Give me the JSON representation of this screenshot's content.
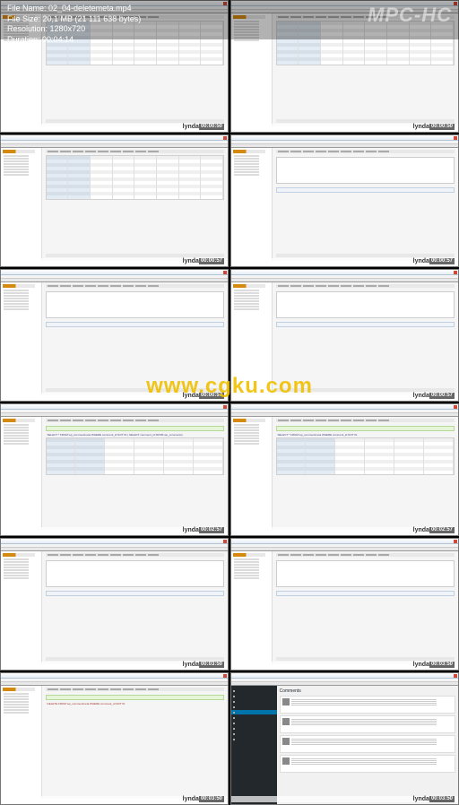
{
  "header": {
    "file_name_label": "File Name:",
    "file_name": "02_04-deletemeta.mp4",
    "file_size_label": "File Size:",
    "file_size": "20,1 MB (21 111 638 bytes)",
    "resolution_label": "Resolution:",
    "resolution": "1280x720",
    "duration_label": "Duration:",
    "duration": "00:04:14",
    "app_name": "MPC-HC"
  },
  "center_watermark": "www.cgku.com",
  "brand_watermark": "lynda",
  "thumbnails": [
    {
      "type": "pma-table",
      "timestamp": "00:00:50"
    },
    {
      "type": "pma-table",
      "timestamp": "00:00:50"
    },
    {
      "type": "pma-table",
      "timestamp": "00:00:57"
    },
    {
      "type": "pma-query",
      "timestamp": "00:00:57"
    },
    {
      "type": "pma-query",
      "timestamp": "00:00:57"
    },
    {
      "type": "pma-query",
      "timestamp": "00:00:57"
    },
    {
      "type": "pma-results",
      "timestamp": "00:02:57",
      "sql": "SELECT *\nFROM wp_commentmeta\nWHERE comment_id\nNOT IN (\nSELECT comment_id\nFROM wp_comments)"
    },
    {
      "type": "pma-results",
      "timestamp": "00:02:57",
      "sql": "SELECT *\nFROM wp_commentmeta\nWHERE comment_id NOT IN"
    },
    {
      "type": "pma-query",
      "timestamp": "00:03:50"
    },
    {
      "type": "pma-query",
      "timestamp": "00:03:50"
    },
    {
      "type": "pma-delete",
      "timestamp": "00:03:50",
      "sql": "DELETE FROM wp_commentmeta WHERE comment_id NOT IN"
    },
    {
      "type": "wp-comments",
      "timestamp": "00:03:50",
      "title": "Comments",
      "wp_menu": [
        "Dashboard",
        "Posts",
        "Media",
        "Pages",
        "Comments",
        "Appearance",
        "Plugins",
        "Users",
        "Tools",
        "Settings"
      ]
    }
  ]
}
